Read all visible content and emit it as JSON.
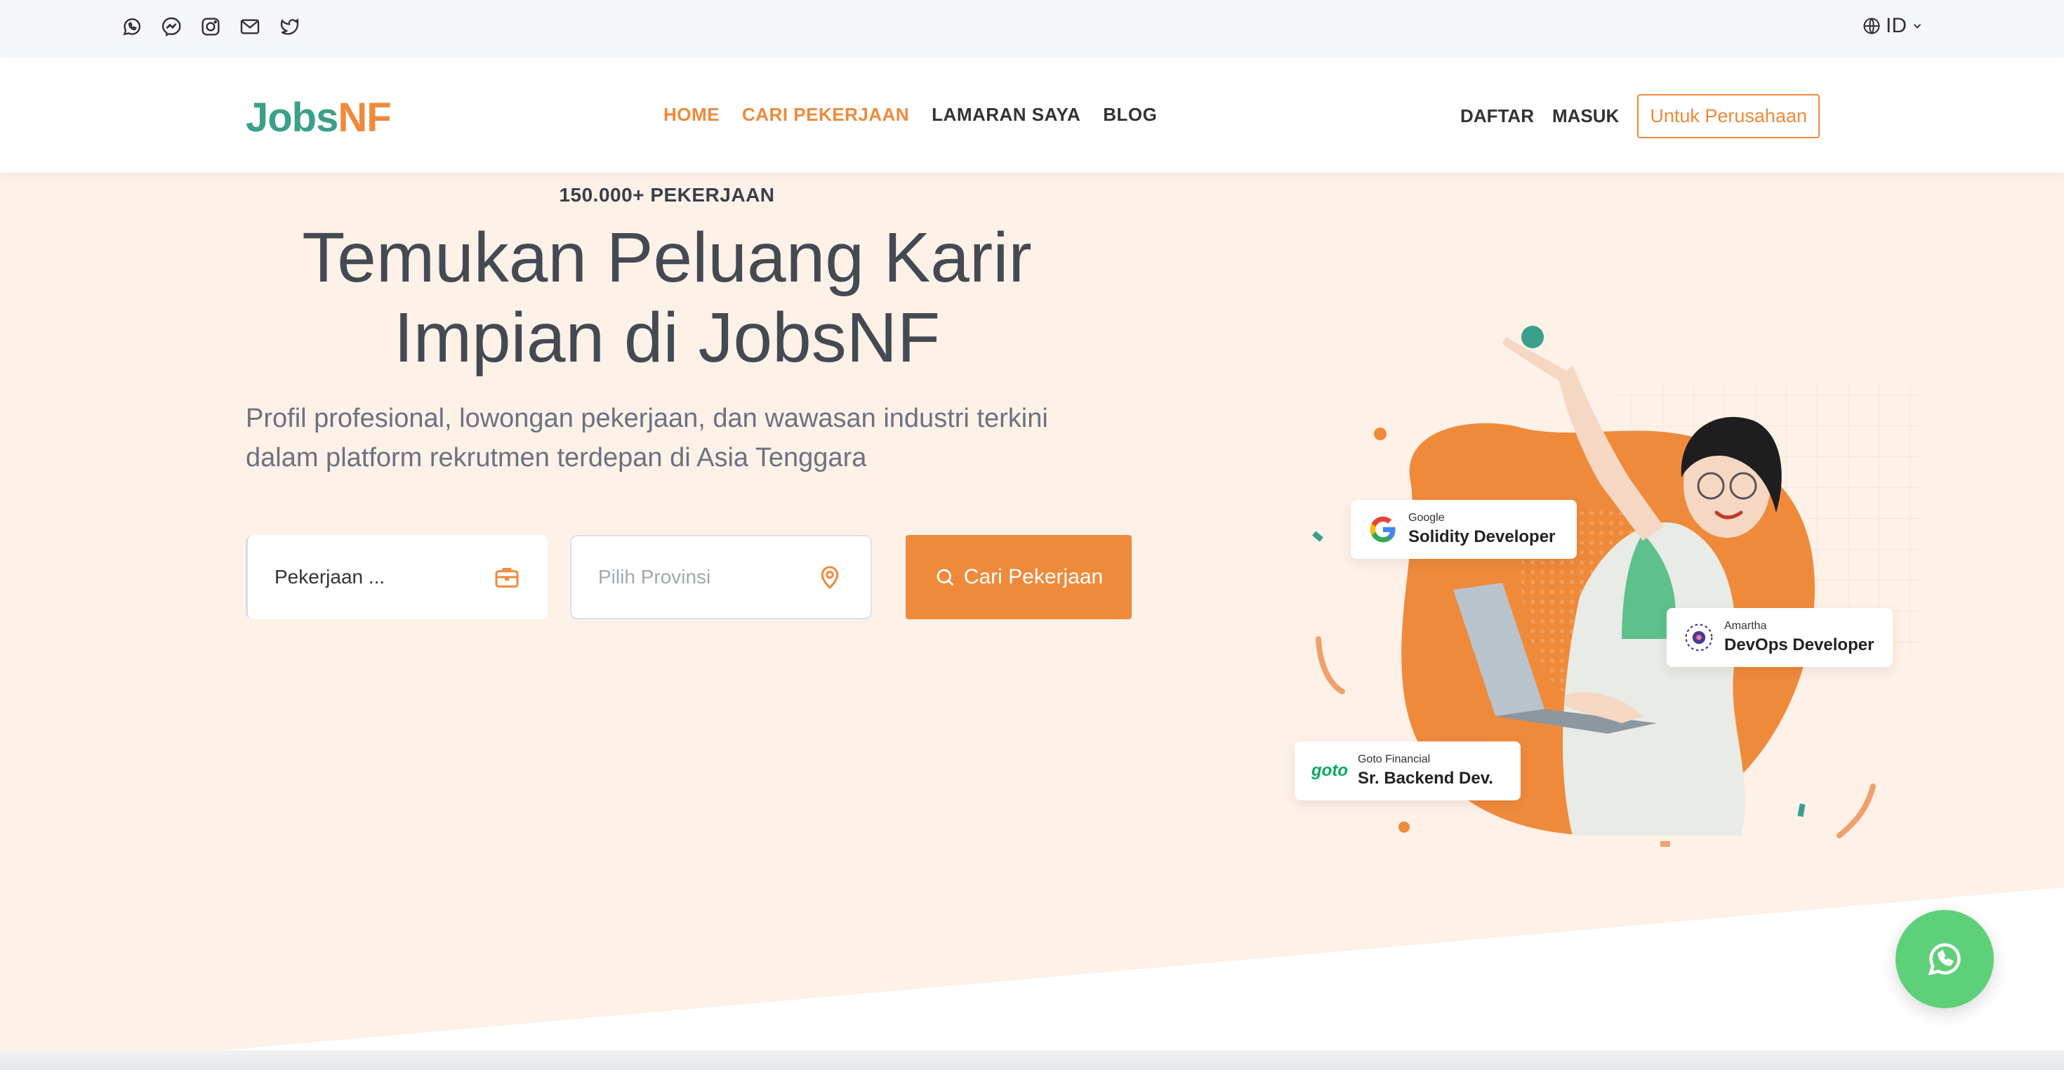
{
  "topbar": {
    "social_icons": [
      "whatsapp-icon",
      "messenger-icon",
      "instagram-icon",
      "mail-icon",
      "twitter-icon"
    ],
    "language": "ID"
  },
  "nav": {
    "logo_part1": "Jobs",
    "logo_part2": "NF",
    "items": [
      {
        "label": "HOME",
        "active": true
      },
      {
        "label": "CARI PEKERJAAN",
        "active": true
      },
      {
        "label": "LAMARAN SAYA",
        "active": false
      },
      {
        "label": "BLOG",
        "active": false
      }
    ],
    "register": "DAFTAR",
    "login": "MASUK",
    "company_button": "Untuk Perusahaan"
  },
  "hero": {
    "count": "150.000+ PEKERJAAN",
    "headline_line1": "Temukan Peluang Karir",
    "headline_line2": "Impian di JobsNF",
    "subtitle_line1": "Profil profesional, lowongan pekerjaan, dan wawasan industri terkini",
    "subtitle_line2": "dalam platform rekrutmen terdepan di Asia Tenggara"
  },
  "search": {
    "job_value": "Pekerjaan ...",
    "province_placeholder": "Pilih Provinsi",
    "button_label": "Cari Pekerjaan"
  },
  "cards": [
    {
      "company": "Google",
      "role": "Solidity Developer"
    },
    {
      "company": "Amartha",
      "role": "DevOps Developer"
    },
    {
      "company": "Goto Financial",
      "role": "Sr. Backend Dev."
    }
  ],
  "goto_logo_text": "goto",
  "colors": {
    "brand_orange": "#ef8a3b",
    "brand_green": "#3ba08a",
    "hero_bg": "#fdf1e8",
    "whatsapp_green": "#5fd07a"
  }
}
